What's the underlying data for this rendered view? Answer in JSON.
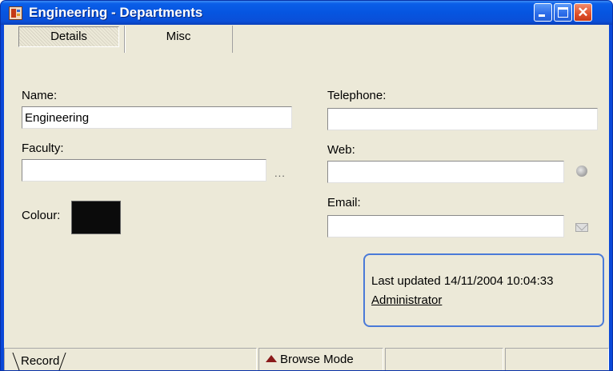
{
  "window": {
    "title": "Engineering - Departments",
    "title_bar_color": "#0a5ee8",
    "buttons": [
      "minimize-icon",
      "maximize-icon",
      "close-icon"
    ],
    "close_glyph": "✕"
  },
  "tabs": [
    {
      "label": "Details",
      "active": true
    },
    {
      "label": "Misc",
      "active": false
    }
  ],
  "form": {
    "name_label": "Name:",
    "name_value": "Engineering",
    "faculty_label": "Faculty:",
    "faculty_value": "",
    "faculty_browse": "...",
    "colour_label": "Colour:",
    "colour_value": "#0b0b0b",
    "telephone_label": "Telephone:",
    "telephone_value": "",
    "web_label": "Web:",
    "web_value": "",
    "email_label": "Email:",
    "email_value": ""
  },
  "info": {
    "last_updated": "Last updated 14/11/2004 10:04:33",
    "user": "Administrator"
  },
  "status": {
    "record_tab": "Record",
    "mode": "Browse Mode",
    "mode_icon_color": "#8a1a1a"
  }
}
